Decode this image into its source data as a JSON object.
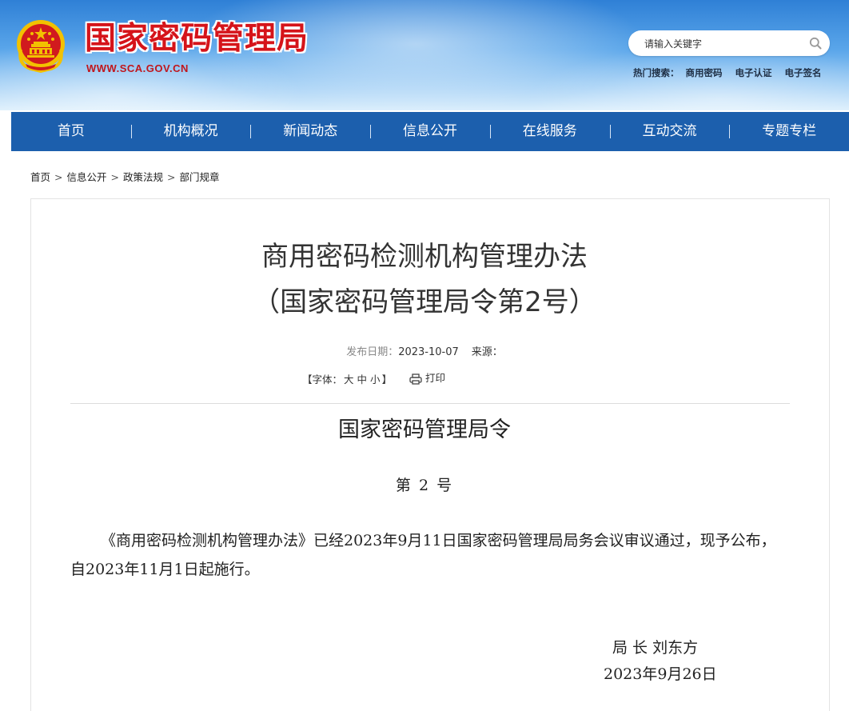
{
  "header": {
    "title": "国家密码管理局",
    "url": "WWW.SCA.GOV.CN",
    "search_placeholder": "请输入关键字",
    "hot_label": "热门搜索：",
    "hot_links": [
      "商用密码",
      "电子认证",
      "电子签名"
    ]
  },
  "nav": {
    "items": [
      "首页",
      "机构概况",
      "新闻动态",
      "信息公开",
      "在线服务",
      "互动交流",
      "专题专栏"
    ]
  },
  "breadcrumb": [
    "首页",
    "信息公开",
    "政策法规",
    "部门规章"
  ],
  "breadcrumb_sep": ">",
  "article": {
    "title_line1": "商用密码检测机构管理办法",
    "title_line2": "（国家密码管理局令第2号）",
    "date_label": "发布日期：",
    "date": "2023-10-07",
    "source_label": "来源：",
    "font_open": "【字体：",
    "font_sizes": [
      "大",
      "中",
      "小"
    ],
    "font_close": "】",
    "print_label": "打印",
    "order_heading": "国家密码管理局令",
    "order_no": "第 2 号",
    "body": "《商用密码检测机构管理办法》已经2023年9月11日国家密码管理局局务会议审议通过，现予公布，自2023年11月1日起施行。",
    "signer": "局 长 刘东方",
    "sign_date": "2023年9月26日"
  },
  "colors": {
    "title_red": "#d5141a",
    "nav_blue": "#1c5fad",
    "header_sky": "#5aa6ea"
  }
}
